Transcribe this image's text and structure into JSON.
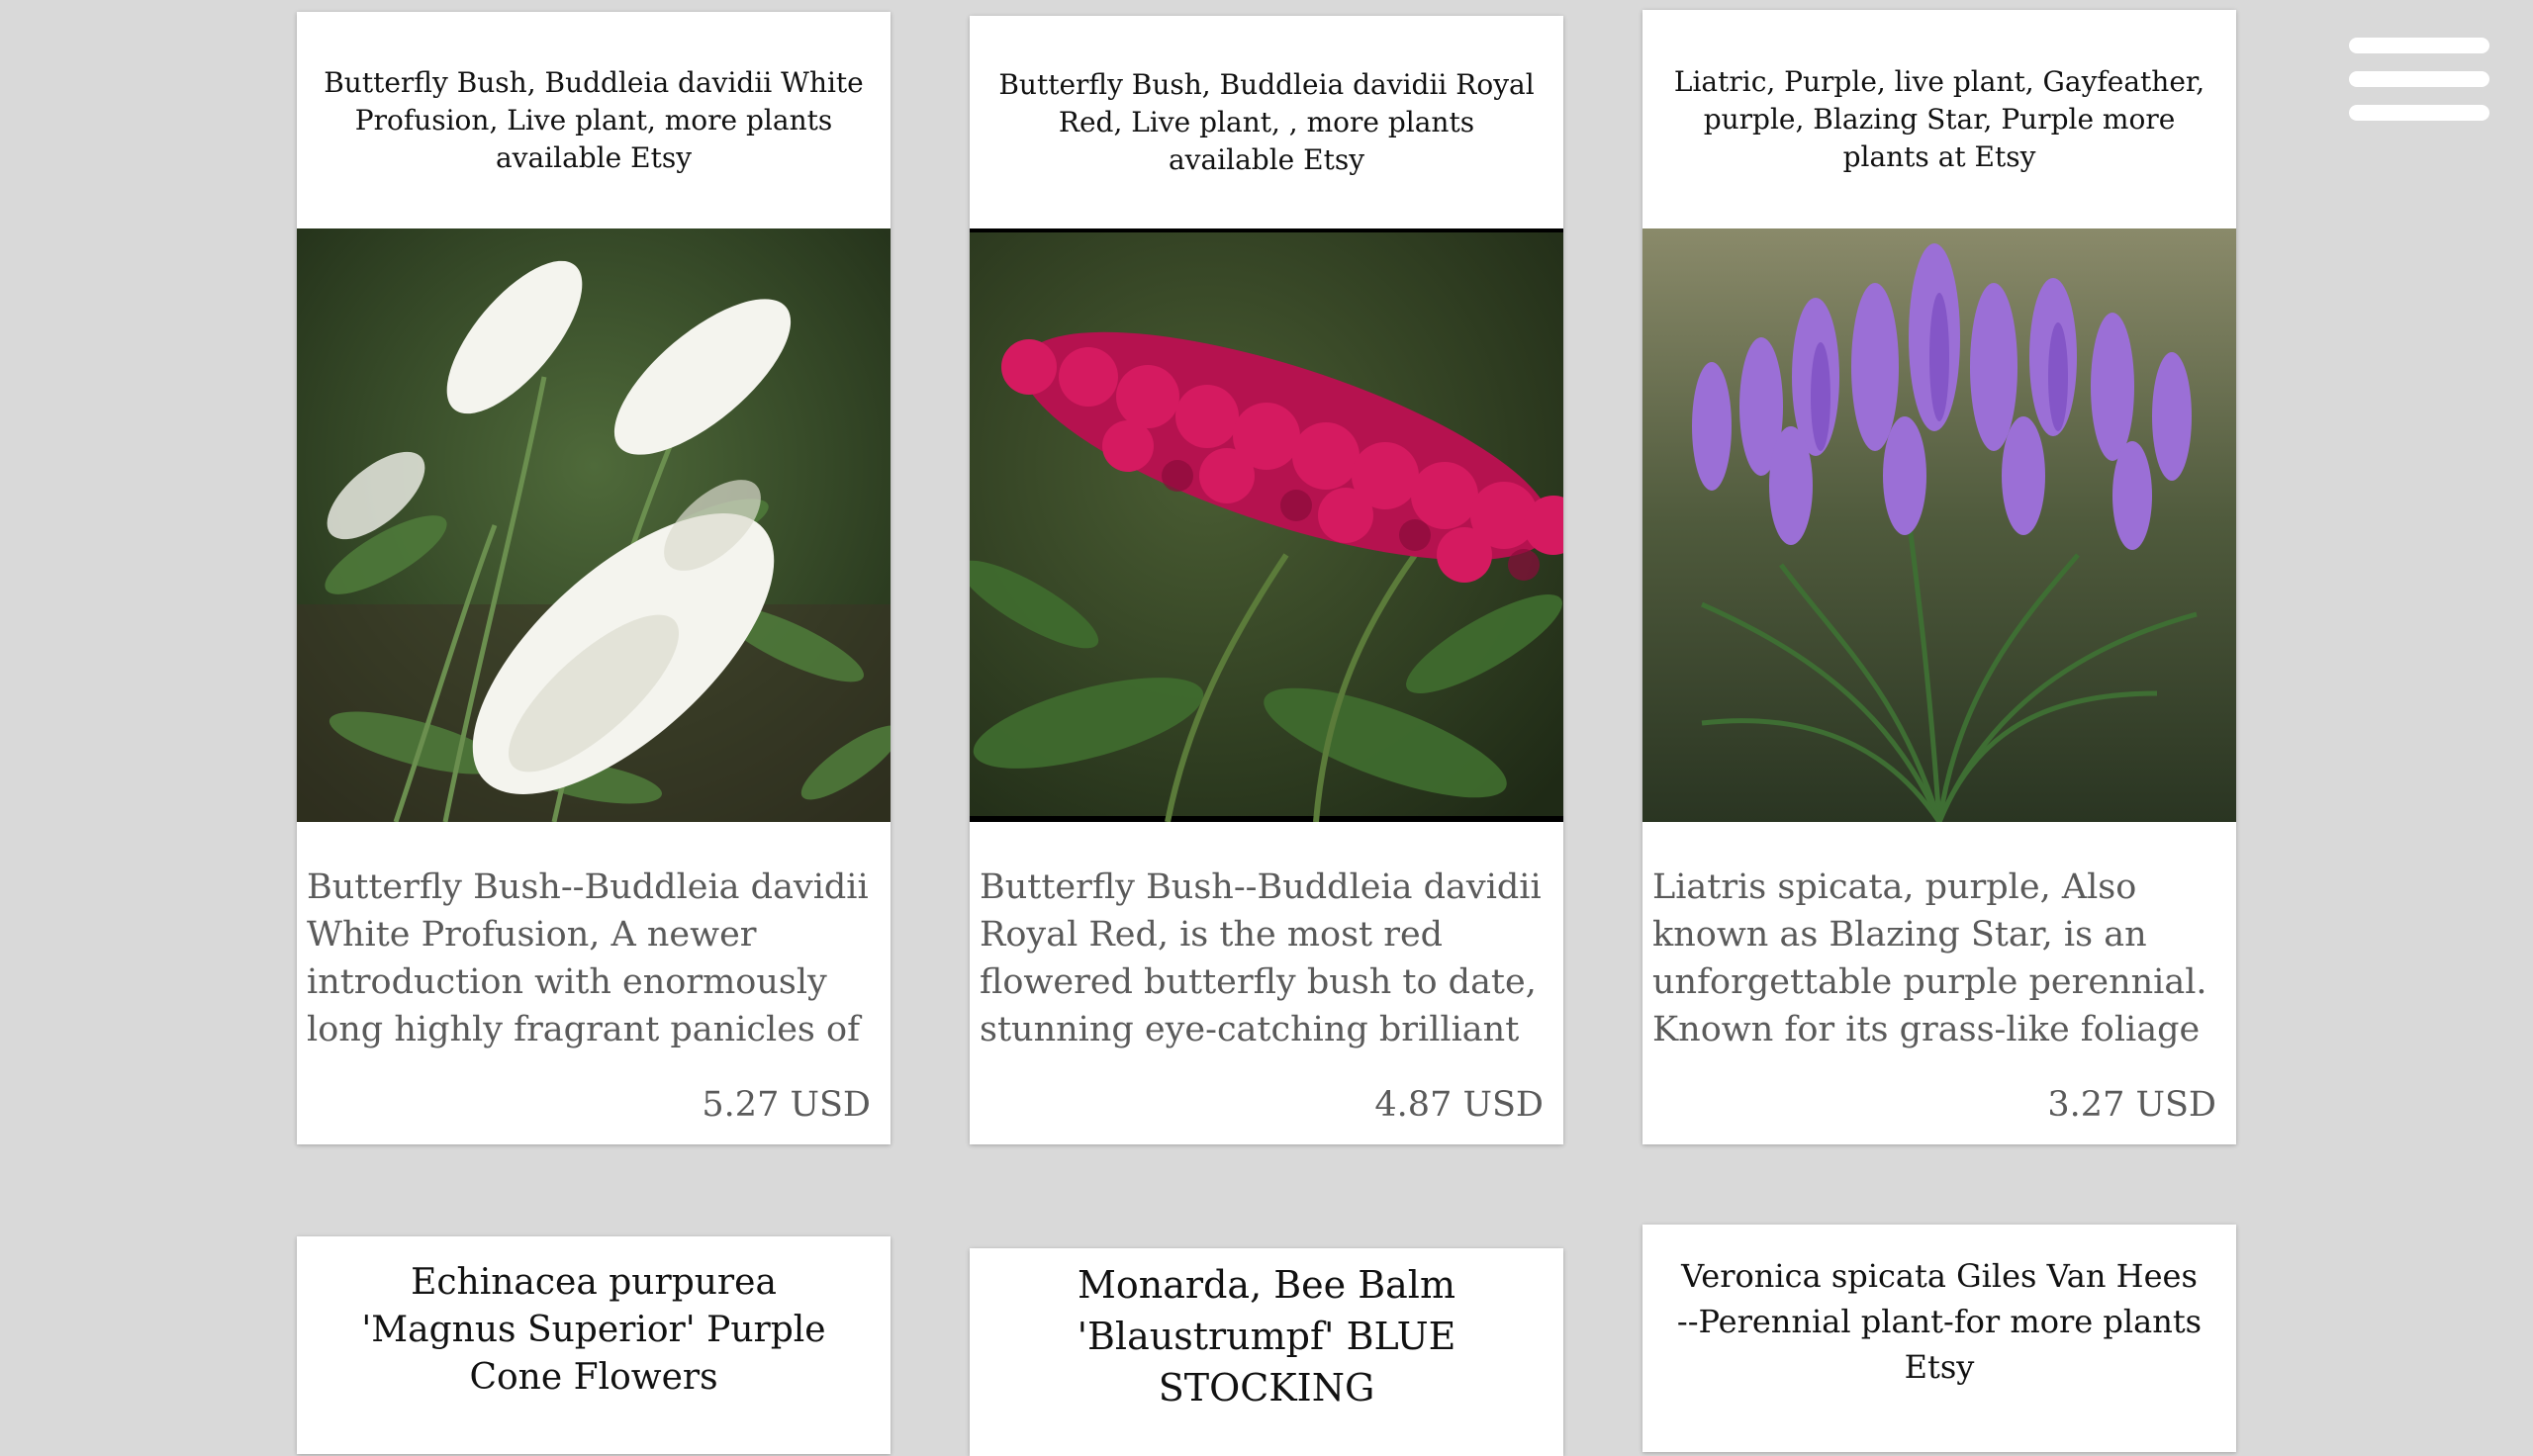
{
  "menu": {
    "icon": "hamburger-menu-icon"
  },
  "cards": [
    {
      "title": "Butterfly Bush, Buddleia davidii White Profusion, Live plant, more plants available Etsy",
      "image": "white-butterfly-bush-image",
      "description": "Butterfly Bush--Buddleia davidii White Profusion, A newer introduction with enormously long highly fragrant panicles of pure white flowers with tiny yellow eyes",
      "price": "5.27 USD"
    },
    {
      "title": "Butterfly Bush, Buddleia davidii Royal Red, Live plant, , more plants available Etsy",
      "image": "royal-red-butterfly-bush-image",
      "description": "Butterfly Bush--Buddleia davidii Royal Red, is the most red flowered butterfly bush to date, stunning eye-catching brilliant purple with an red cast, and a stout purple habit",
      "price": "4.87 USD"
    },
    {
      "title": "Liatric, Purple, live plant, Gayfeather, purple, Blazing Star, Purple more plants at Etsy",
      "image": "purple-liatris-image",
      "description": "Liatris spicata, purple, Also known as Blazing Star, is an unforgettable purple perennial. Known for its grass-like foliage and tall, spiky blooms that attract butterflies, birds and bees",
      "price": "3.27 USD"
    },
    {
      "title": "Echinacea purpurea 'Magnus Superior' Purple Cone Flowers"
    },
    {
      "title": "Monarda, Bee Balm 'Blaustrumpf' BLUE STOCKING"
    },
    {
      "title": "Veronica spicata Giles Van Hees --Perennial plant-for more plants Etsy"
    }
  ]
}
